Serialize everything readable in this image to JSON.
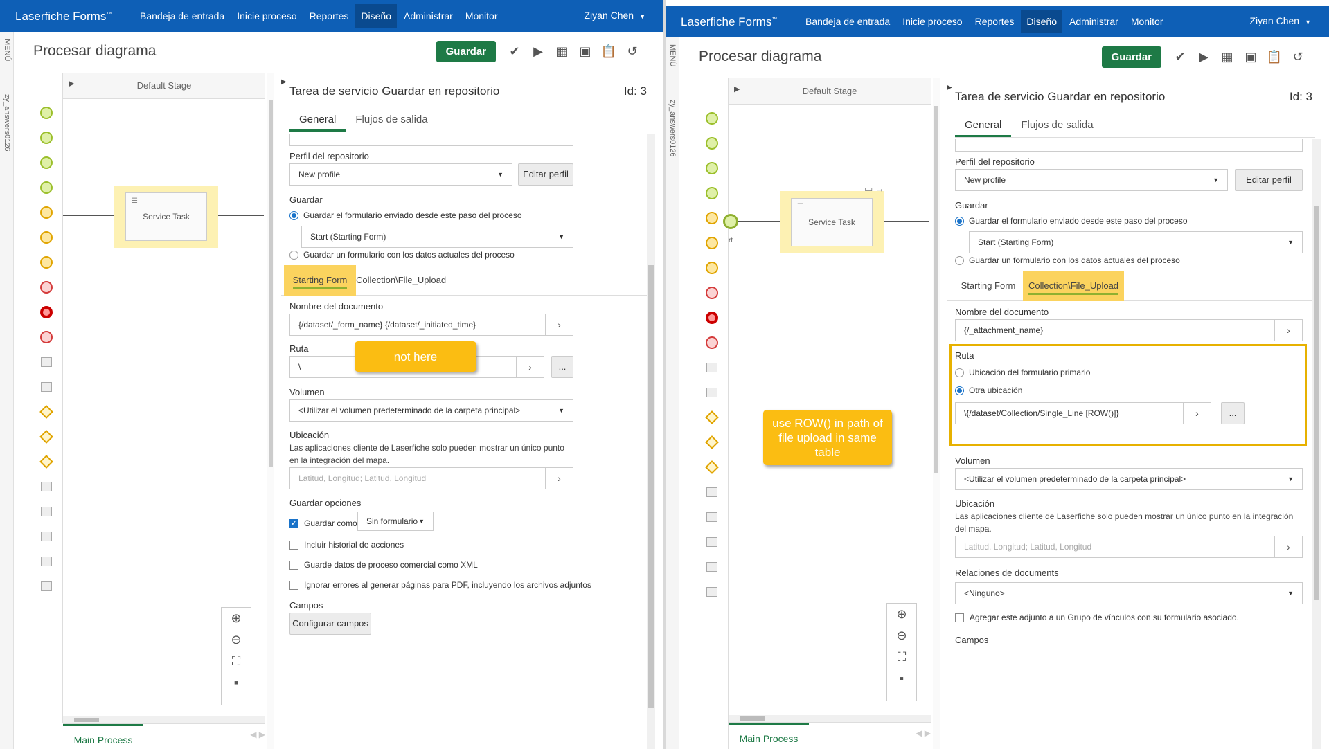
{
  "app": {
    "brand": "Laserfiche Forms",
    "trademark": "™",
    "user": "Ziyan Chen"
  },
  "nav": [
    "Bandeja de entrada",
    "Inicie proceso",
    "Reportes",
    "Diseño",
    "Administrar",
    "Monitor"
  ],
  "nav_active": "Diseño",
  "menu_label": "MENÚ",
  "left_strip_label": "zy_answers0126",
  "page_title": "Procesar diagrama",
  "toolbar": {
    "save": "Guardar"
  },
  "canvas": {
    "stage": "Default Stage",
    "task": "Service Task",
    "start_label": "rt",
    "process_tab": "Main Process"
  },
  "panel": {
    "title": "Tarea de servicio Guardar en repositorio",
    "id": "Id: 3",
    "tabs": [
      "General",
      "Flujos de salida"
    ],
    "repo_profile_label": "Perfil del repositorio",
    "repo_profile_value": "New profile",
    "edit_profile": "Editar perfil",
    "guardar_label": "Guardar",
    "radio_submitted": "Guardar el formulario enviado desde este paso del proceso",
    "form_select": "Start (Starting Form)",
    "radio_current": "Guardar un formulario con los datos actuales del proceso",
    "subtabs": [
      "Starting Form",
      "Collection\\File_Upload"
    ],
    "docname_label": "Nombre del documento",
    "ruta_label": "Ruta",
    "volume_label": "Volumen",
    "volume_value": "<Utilizar el volumen predeterminado de la carpeta principal>",
    "location_label": "Ubicación",
    "location_hint": "Las aplicaciones cliente de Laserfiche solo pueden mostrar un único punto en la integración del mapa.",
    "location_placeholder": "Latitud, Longitud; Latitud, Longitud",
    "ellipsis": "...",
    "arrow": "›"
  },
  "left": {
    "docname_value": "{/dataset/_form_name} {/dataset/_initiated_time}",
    "ruta_value": "\\",
    "save_options_label": "Guardar opciones",
    "save_as": "Guardar como",
    "save_as_select": "Sin formulario",
    "opt_history": "Incluir historial de acciones",
    "opt_xml": "Guarde datos de proceso comercial como XML",
    "opt_ignore": "Ignorar errores al generar páginas para PDF, incluyendo los archivos adjuntos",
    "fields_label": "Campos",
    "configure_fields": "Configurar campos",
    "callout": "not here"
  },
  "right": {
    "docname_value": "{/_attachment_name}",
    "ruta_opt_primary": "Ubicación del formulario primario",
    "ruta_opt_other": "Otra ubicación",
    "ruta_value": "\\{/dataset/Collection/Single_Line [ROW()]}",
    "relations_label": "Relaciones de documents",
    "relations_value": "<Ninguno>",
    "attach_group": "Agregar este adjunto a un Grupo de vínculos con su formulario asociado.",
    "fields_label": "Campos",
    "callout": "use ROW() in path of file upload in same table"
  }
}
